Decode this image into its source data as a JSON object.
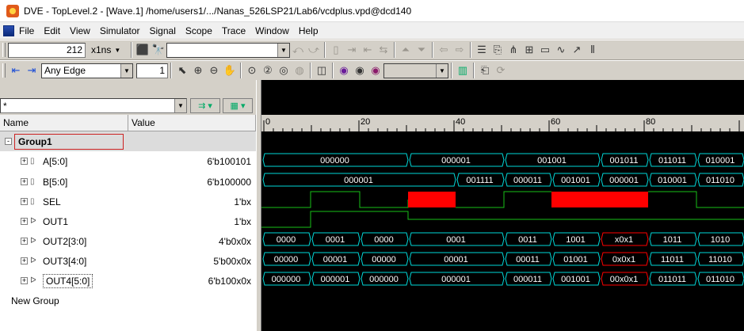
{
  "window": {
    "title": "DVE - TopLevel.2 - [Wave.1]  /home/users1/.../Nanas_526LSP21/Lab6/vcdplus.vpd@dcd140"
  },
  "menu": [
    "File",
    "Edit",
    "View",
    "Simulator",
    "Signal",
    "Scope",
    "Trace",
    "Window",
    "Help"
  ],
  "toolbar1": {
    "time_value": "212",
    "time_unit": "x1ns"
  },
  "toolbar2": {
    "edge": "Any Edge",
    "count": "1"
  },
  "filter": {
    "value": "*"
  },
  "columns": {
    "name": "Name",
    "value": "Value"
  },
  "colors": {
    "wave_bus": "#00d8d8",
    "wave_bit": "#18c018",
    "x_fill": "#ff0000",
    "group_border": "#cc2222"
  },
  "ruler": {
    "labels": [
      "0",
      "20",
      "40",
      "60",
      "80"
    ]
  },
  "signals": [
    {
      "name": "Group1",
      "value": "",
      "kind": "group"
    },
    {
      "name": "A[5:0]",
      "value": "6'b100101",
      "kind": "bus"
    },
    {
      "name": "B[5:0]",
      "value": "6'b100000",
      "kind": "bus"
    },
    {
      "name": "SEL",
      "value": "1'bx",
      "kind": "bit"
    },
    {
      "name": "OUT1",
      "value": "1'bx",
      "kind": "bit"
    },
    {
      "name": "OUT2[3:0]",
      "value": "4'b0x0x",
      "kind": "bus"
    },
    {
      "name": "OUT3[4:0]",
      "value": "5'b00x0x",
      "kind": "bus"
    },
    {
      "name": "OUT4[5:0]",
      "value": "6'b100x0x",
      "kind": "bus"
    },
    {
      "name": "New Group",
      "value": "",
      "kind": "group"
    }
  ],
  "waves": {
    "A": [
      "000000",
      "000001",
      "001001",
      "001011",
      "011011",
      "010001"
    ],
    "B": [
      "000001",
      "001111",
      "000011",
      "001001",
      "000001",
      "010001",
      "011010"
    ],
    "OUT2": [
      "0000",
      "0001",
      "0000",
      "0001",
      "0011",
      "1001",
      "x0x1",
      "1011",
      "1010"
    ],
    "OUT3": [
      "00000",
      "00001",
      "00000",
      "00001",
      "00011",
      "01001",
      "0x0x1",
      "11011",
      "11010"
    ],
    "OUT4": [
      "000000",
      "000001",
      "000000",
      "000001",
      "000011",
      "001001",
      "00x0x1",
      "011011",
      "011010"
    ]
  }
}
